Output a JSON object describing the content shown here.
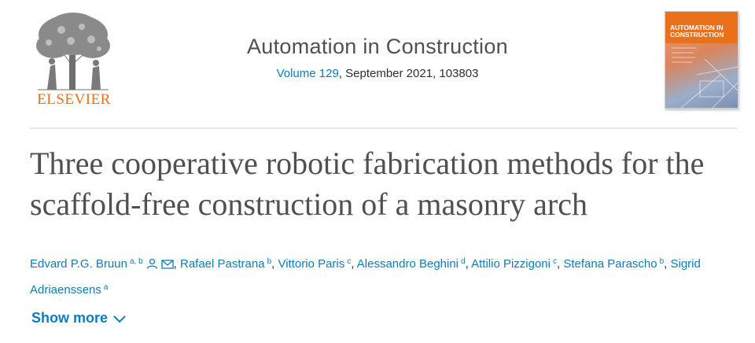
{
  "header": {
    "publisher_logo_text": "ELSEVIER",
    "journal_title": "Automation in Construction",
    "volume_link": "Volume 129",
    "issue_info": ", September 2021, 103803",
    "cover_title": "AUTOMATION IN CONSTRUCTION"
  },
  "article": {
    "title": "Three cooperative robotic fabrication methods for the scaffold-free construction of a masonry arch",
    "authors": [
      {
        "name": "Edvard P.G. Bruun",
        "affiliations": "a, b",
        "icons": [
          "person-icon",
          "envelope-icon"
        ]
      },
      {
        "name": "Rafael Pastrana",
        "affiliations": "b"
      },
      {
        "name": "Vittorio Paris",
        "affiliations": "c"
      },
      {
        "name": "Alessandro Beghini",
        "affiliations": "d"
      },
      {
        "name": "Attilio Pizzigoni",
        "affiliations": "c"
      },
      {
        "name": "Stefana Parascho",
        "affiliations": "b"
      },
      {
        "name": "Sigrid Adriaenssens",
        "affiliations": "a"
      }
    ],
    "separator": ", ",
    "show_more_label": "Show more"
  },
  "colors": {
    "link": "#0c7dbb",
    "elsevier_orange": "#e9711c",
    "title_gray": "#505050"
  }
}
